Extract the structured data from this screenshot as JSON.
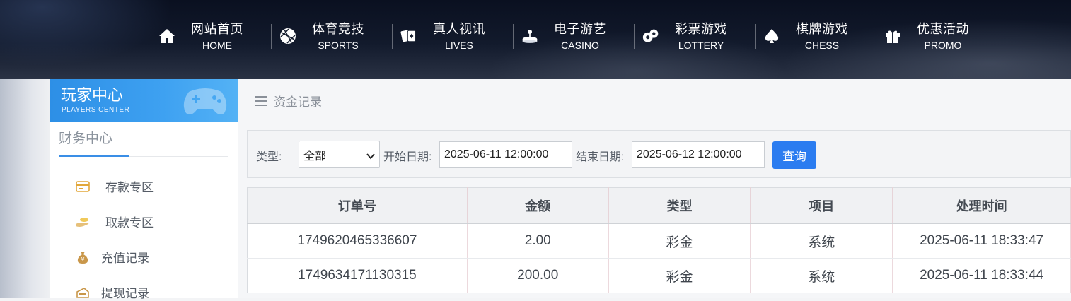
{
  "nav": {
    "items": [
      {
        "cn": "网站首页",
        "en": "HOME",
        "icon": "home-icon"
      },
      {
        "cn": "体育竞技",
        "en": "SPORTS",
        "icon": "basketball-icon"
      },
      {
        "cn": "真人视讯",
        "en": "LIVES",
        "icon": "playing-cards-icon"
      },
      {
        "cn": "电子游艺",
        "en": "CASINO",
        "icon": "joystick-icon"
      },
      {
        "cn": "彩票游戏",
        "en": "LOTTERY",
        "icon": "lottery-balls-icon"
      },
      {
        "cn": "棋牌游戏",
        "en": "CHESS",
        "icon": "spade-icon"
      },
      {
        "cn": "优惠活动",
        "en": "PROMO",
        "icon": "gift-icon"
      }
    ]
  },
  "sidebar": {
    "title": "玩家中心",
    "subtitle": "PLAYERS CENTER",
    "tab": "财务中心",
    "items": [
      {
        "label": "存款专区",
        "icon": "deposit-card-icon"
      },
      {
        "label": "取款专区",
        "icon": "withdraw-hand-icon"
      },
      {
        "label": "充值记录",
        "icon": "money-bag-icon"
      },
      {
        "label": "提现记录",
        "icon": "withdraw-record-icon"
      }
    ]
  },
  "breadcrumb": {
    "label": "资金记录",
    "icon": "menu-icon"
  },
  "filter": {
    "type_label": "类型:",
    "type_value": "全部",
    "start_label": "开始日期:",
    "start_value": "2025-06-11 12:00:00",
    "end_label": "结束日期:",
    "end_value": "2025-06-12 12:00:00",
    "query_button": "查询"
  },
  "table": {
    "columns": [
      "订单号",
      "金额",
      "类型",
      "项目",
      "处理时间"
    ],
    "rows": [
      [
        "1749620465336607",
        "2.00",
        "彩金",
        "系统",
        "2025-06-11 18:33:47"
      ],
      [
        "1749634171130315",
        "200.00",
        "彩金",
        "系统",
        "2025-06-11 18:33:44"
      ]
    ]
  },
  "colors": {
    "accent": "#2b7cf0",
    "sidebar_header": "#3ea1f1",
    "nav_bg": "#0e1626"
  }
}
